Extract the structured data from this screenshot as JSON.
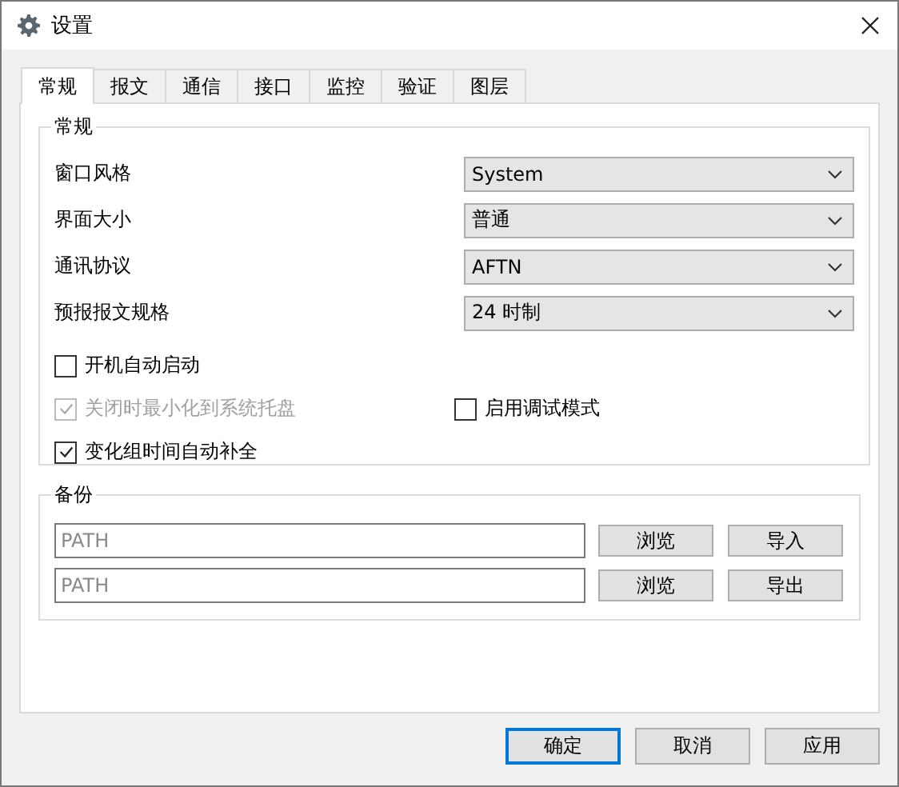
{
  "window": {
    "title": "设置"
  },
  "tabs": [
    {
      "label": "常规",
      "selected": true
    },
    {
      "label": "报文",
      "selected": false
    },
    {
      "label": "通信",
      "selected": false
    },
    {
      "label": "接口",
      "selected": false
    },
    {
      "label": "监控",
      "selected": false
    },
    {
      "label": "验证",
      "selected": false
    },
    {
      "label": "图层",
      "selected": false
    }
  ],
  "general": {
    "title": "常规",
    "settings": [
      {
        "label": "窗口风格",
        "value": "System"
      },
      {
        "label": "界面大小",
        "value": "普通"
      },
      {
        "label": "通讯协议",
        "value": "AFTN"
      },
      {
        "label": "预报报文规格",
        "value": "24 时制"
      }
    ],
    "checkbox_rows": [
      [
        {
          "label": "开机自动启动",
          "checked": false,
          "disabled": false
        }
      ],
      [
        {
          "label": "关闭时最小化到系统托盘",
          "checked": true,
          "disabled": true
        },
        {
          "label": "启用调试模式",
          "checked": false,
          "disabled": false
        }
      ],
      [
        {
          "label": "变化组时间自动补全",
          "checked": true,
          "disabled": false
        }
      ]
    ]
  },
  "backup": {
    "title": "备份",
    "rows": [
      {
        "placeholder": "PATH",
        "browse": "浏览",
        "action": "导入"
      },
      {
        "placeholder": "PATH",
        "browse": "浏览",
        "action": "导出"
      }
    ]
  },
  "buttons": [
    {
      "label": "确定",
      "default": true
    },
    {
      "label": "取消",
      "default": false
    },
    {
      "label": "应用",
      "default": false
    }
  ]
}
